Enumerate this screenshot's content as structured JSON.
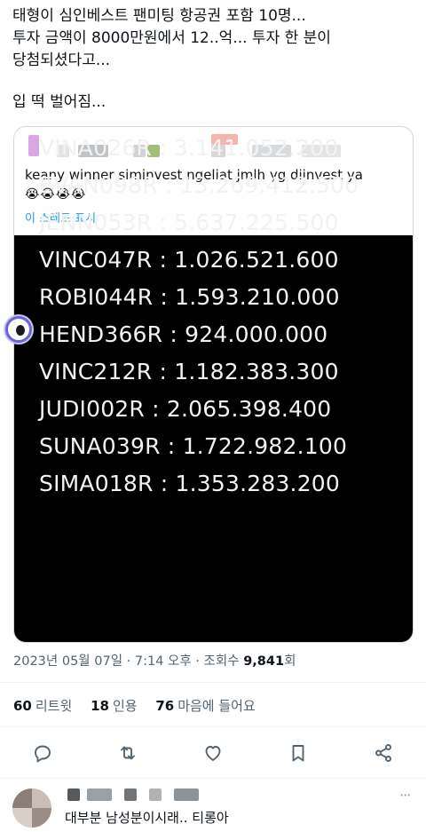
{
  "tweet": {
    "lines": [
      "태형이 심인베스트 팬미팅 항공권 포함 10명...",
      "투자 금액이 8000만원에서 12..억... 투자 한 분이",
      "당첨되셨다고...",
      "입 떡 벌어짐..."
    ]
  },
  "quote": {
    "text": "keany winner siminvest ngeliat jmlh yg diinvest ya",
    "emoji": "😭😭😭😭",
    "thread_link": "이 스레드 표시"
  },
  "winners": [
    "VINA026R : 3.141.052.200",
    "EVAN098R : 13.269.412.500",
    "JENN053R : 5.637.225.500",
    "VINC047R : 1.026.521.600",
    "ROBI044R : 1.593.210.000",
    "HEND366R : 924.000.000",
    "VINC212R : 1.182.383.300",
    "JUDI002R : 2.065.398.400",
    "SUNA039R : 1.722.982.100",
    "SIMA018R : 1.353.283.200"
  ],
  "meta": {
    "datetime": "2023년 05월 07일 · 7:14 오후 · 조회수 ",
    "views": "9,841",
    "views_suffix": "회"
  },
  "stats": {
    "retweets": "60",
    "retweets_label": "리트윗",
    "quotes": "18",
    "quotes_label": "인용",
    "likes": "76",
    "likes_label": "마음에 들어요"
  },
  "actions": [
    "reply-icon",
    "retweet-icon",
    "like-icon",
    "bookmark-icon",
    "share-icon"
  ],
  "reply": {
    "more": "···",
    "text": "대부분 남성분이시래.. 티롱아"
  },
  "colors": {
    "link": "#1d9bf0",
    "muted": "#536471",
    "text": "#0f1419",
    "border": "#cfd9de"
  }
}
